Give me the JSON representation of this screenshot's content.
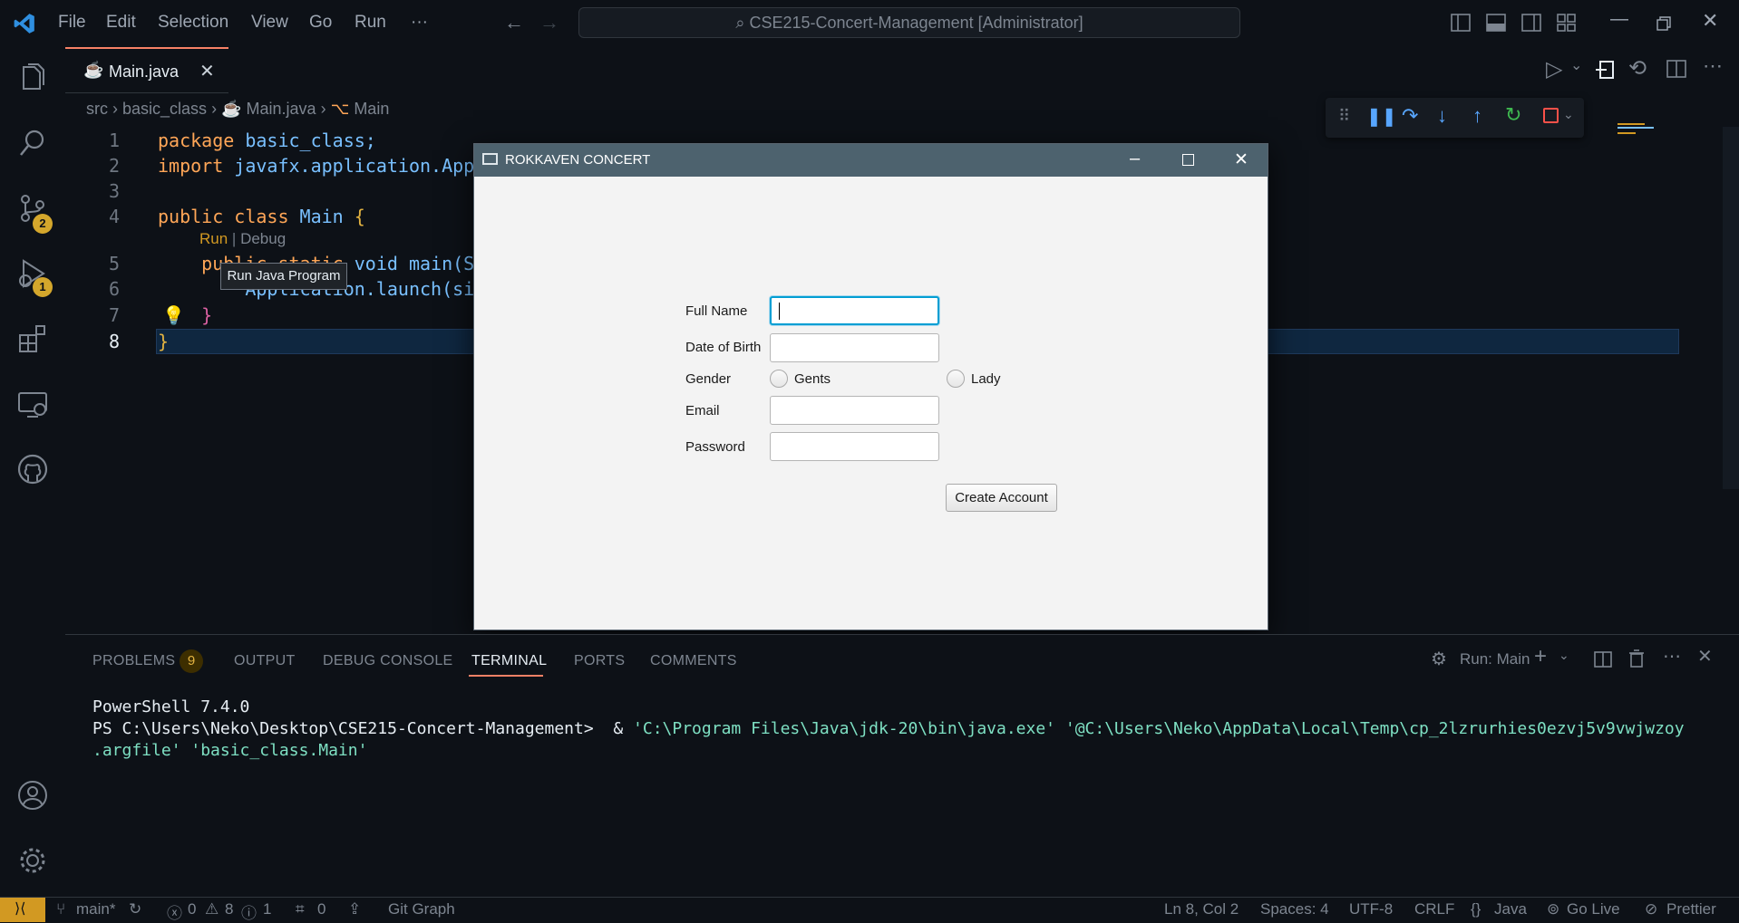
{
  "menu": [
    "File",
    "Edit",
    "Selection",
    "View",
    "Go",
    "Run",
    "···"
  ],
  "command_center": "CSE215-Concert-Management [Administrator]",
  "activity_badges": {
    "source_control": "2",
    "run_debug": "1"
  },
  "tab": {
    "label": "Main.java"
  },
  "breadcrumb": {
    "src": "src",
    "pkg": "basic_class",
    "file": "Main.java",
    "symbol": "Main"
  },
  "code": {
    "lines": [
      "1",
      "2",
      "3",
      "4",
      "5",
      "6",
      "7",
      "8"
    ],
    "l1_kw": "package",
    "l1_rest": " basic_class;",
    "l2_kw": "import",
    "l2_rest": " javafx.application.Appl",
    "l4_kw": "public class",
    "l4_name": " Main",
    "l4_brace": " {",
    "codelens_run": "Run",
    "codelens_sep": " | ",
    "codelens_debug": "Debug",
    "l5_a": "    publ",
    "l5_b": "ic static ",
    "l5_c": "void main(St",
    "l6_a": "        Application",
    "l6_b": ".launch(sig",
    "l7": "    }",
    "l8": "}"
  },
  "tooltip": "Run Java Program",
  "fx_window": {
    "title": "ROKKAVEN CONCERT",
    "labels": {
      "full_name": "Full Name",
      "dob": "Date of Birth",
      "gender": "Gender",
      "email": "Email",
      "password": "Password"
    },
    "values": {
      "full_name": "",
      "dob": "",
      "email": "",
      "password": ""
    },
    "gender_options": [
      "Gents",
      "Lady"
    ],
    "create_button": "Create Account"
  },
  "panel": {
    "tabs": {
      "problems": "PROBLEMS",
      "problems_count": "9",
      "output": "OUTPUT",
      "debug_console": "DEBUG CONSOLE",
      "terminal": "TERMINAL",
      "ports": "PORTS",
      "comments": "COMMENTS"
    },
    "run_label": "Run: Main",
    "terminal": {
      "l1": "PowerShell 7.4.0",
      "prompt": "PS C:\\Users\\Neko\\Desktop\\CSE215-Concert-Management>  & ",
      "cmd": "'C:\\Program Files\\Java\\jdk-20\\bin\\java.exe' '@C:\\Users\\Neko\\AppData\\Local\\Temp\\cp_2lzrurhies0ezvj5v9vwjwzoy",
      "cmd2": ".argfile' 'basic_class.Main'"
    }
  },
  "status": {
    "branch": "main*",
    "errors": "0",
    "warnings": "8",
    "infos": "1",
    "ports": "0",
    "git_graph": "Git Graph",
    "position": "Ln 8, Col 2",
    "spaces": "Spaces: 4",
    "encoding": "UTF-8",
    "eol": "CRLF",
    "language": "Java",
    "golive": "Go Live",
    "prettier": "Prettier"
  }
}
